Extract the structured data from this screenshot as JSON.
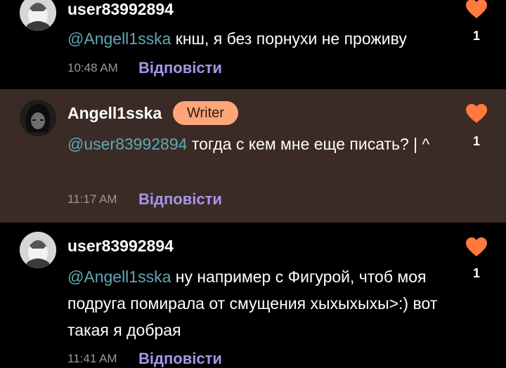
{
  "comments": [
    {
      "username": "user83992894",
      "mention": "@Angell1sska",
      "text": " кнш, я без порнухи не проживу",
      "time": "10:48 AM",
      "reply": "Відповісти",
      "likes": "1"
    },
    {
      "username": "Angell1sska",
      "badge": "Writer",
      "mention": "@user83992894",
      "text": " тогда с кем мне еще писать? | ^",
      "time": "11:17 AM",
      "reply": "Відповісти",
      "likes": "1"
    },
    {
      "username": "user83992894",
      "mention": "@Angell1sska",
      "text": " ну например с Фигурой, чтоб моя подруга помирала от смущения хыхыхыхы>:) вот такая я добрая",
      "time": "11:41 AM",
      "reply": "Відповісти",
      "likes": "1"
    }
  ],
  "colors": {
    "background": "#000000",
    "highlight": "#3a2b27",
    "mention": "#5fa9b6",
    "reply": "#a894e8",
    "heart": "#ff7a3c",
    "badge": "#ffa57a"
  }
}
